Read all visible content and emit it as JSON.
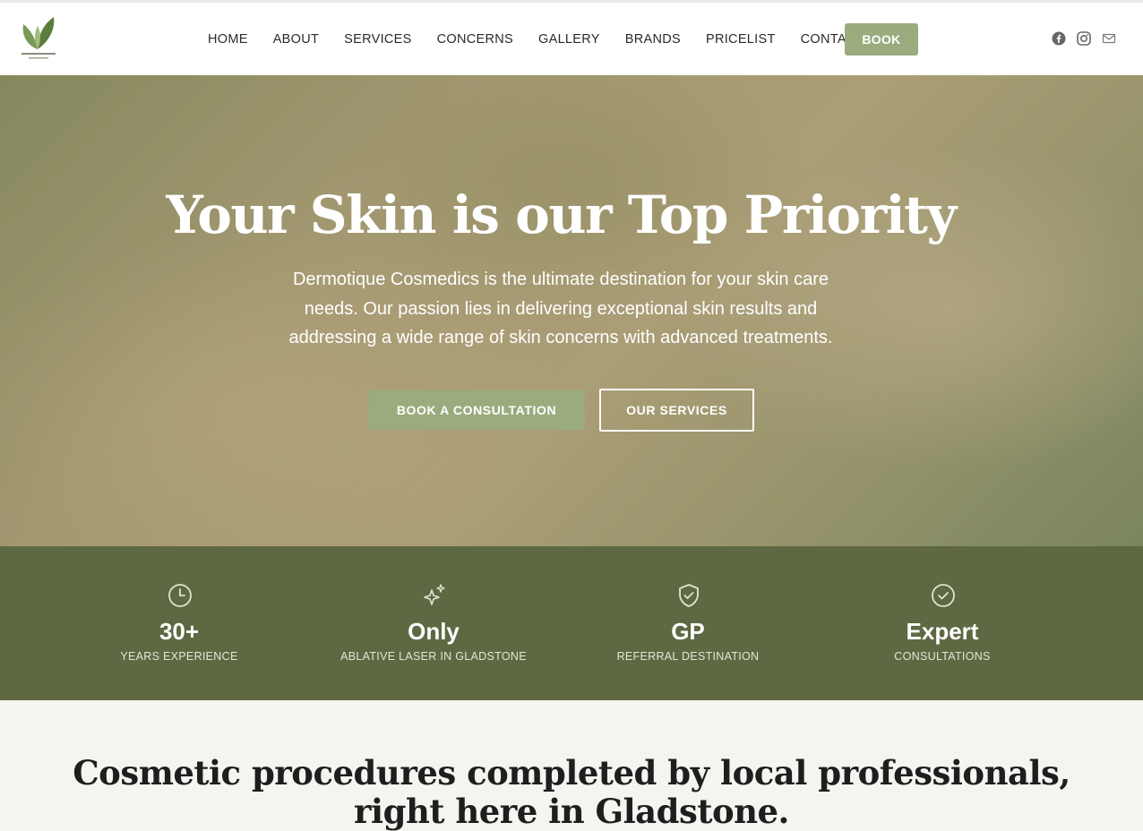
{
  "nav": {
    "items": [
      "HOME",
      "ABOUT",
      "SERVICES",
      "CONCERNS",
      "GALLERY",
      "BRANDS",
      "PRICELIST",
      "CONTACT"
    ],
    "book_label": "BOOK"
  },
  "social": [
    "facebook-icon",
    "instagram-icon",
    "email-icon"
  ],
  "hero": {
    "title": "Your Skin is our Top Priority",
    "text": "Dermotique Cosmedics is the ultimate destination for your skin care needs. Our passion lies in delivering exceptional skin results and addressing a wide range of skin concerns with advanced treatments.",
    "consult_label": "BOOK A CONSULTATION",
    "services_label": "OUR SERVICES"
  },
  "stats": [
    {
      "icon": "clock-icon",
      "big": "30+",
      "small": "YEARS EXPERIENCE"
    },
    {
      "icon": "sparkles-icon",
      "big": "Only",
      "small": "ABLATIVE LASER IN GLADSTONE"
    },
    {
      "icon": "shield-check-icon",
      "big": "GP",
      "small": "REFERRAL DESTINATION"
    },
    {
      "icon": "check-circle-icon",
      "big": "Expert",
      "small": "CONSULTATIONS"
    }
  ],
  "section": {
    "title": "Cosmetic procedures completed by local professionals, right here in Gladstone."
  },
  "colors": {
    "accent": "#9aab7e",
    "stats_bg": "#5e6943",
    "page_bg": "#f4f4f0"
  }
}
